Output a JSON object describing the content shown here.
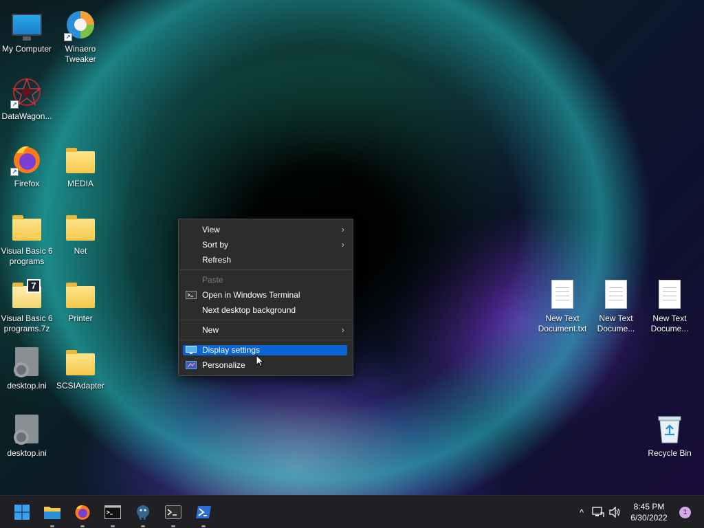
{
  "desktop": {
    "icons": [
      {
        "label": "My Computer"
      },
      {
        "label": "Winaero Tweaker"
      },
      {
        "label": "DataWagon..."
      },
      {
        "label": "Firefox"
      },
      {
        "label": "MEDIA"
      },
      {
        "label": "Visual Basic 6 programs"
      },
      {
        "label": "Net"
      },
      {
        "label": "Visual Basic 6 programs.7z"
      },
      {
        "label": "Printer"
      },
      {
        "label": "desktop.ini"
      },
      {
        "label": "SCSIAdapter"
      },
      {
        "label": "desktop.ini"
      },
      {
        "label": "New Text Document.txt"
      },
      {
        "label": "New Text Docume..."
      },
      {
        "label": "New Text Docume..."
      },
      {
        "label": "Recycle Bin"
      }
    ],
    "sevenzip_badge": "7",
    "shortcut_arrow": "↗"
  },
  "context_menu": {
    "view": "View",
    "sort_by": "Sort by",
    "refresh": "Refresh",
    "paste": "Paste",
    "open_terminal": "Open in Windows Terminal",
    "next_background": "Next desktop background",
    "new": "New",
    "display_settings": "Display settings",
    "personalize": "Personalize",
    "submenu_arrow": "›"
  },
  "taskbar": {
    "apps": [
      "start-icon",
      "file-explorer-icon",
      "firefox-icon",
      "command-prompt-icon",
      "postgresql-icon",
      "terminal-icon",
      "powershell-icon"
    ],
    "tray_chevron": "^",
    "time": "8:45 PM",
    "date": "6/30/2022",
    "notification_count": "1"
  },
  "colors": {
    "menu_bg": "#2c2c2c",
    "highlight": "#0a64d4",
    "taskbar_bg": "#1f1f24",
    "folder": "#f5c84a",
    "notification_badge": "#d7a8e8"
  }
}
